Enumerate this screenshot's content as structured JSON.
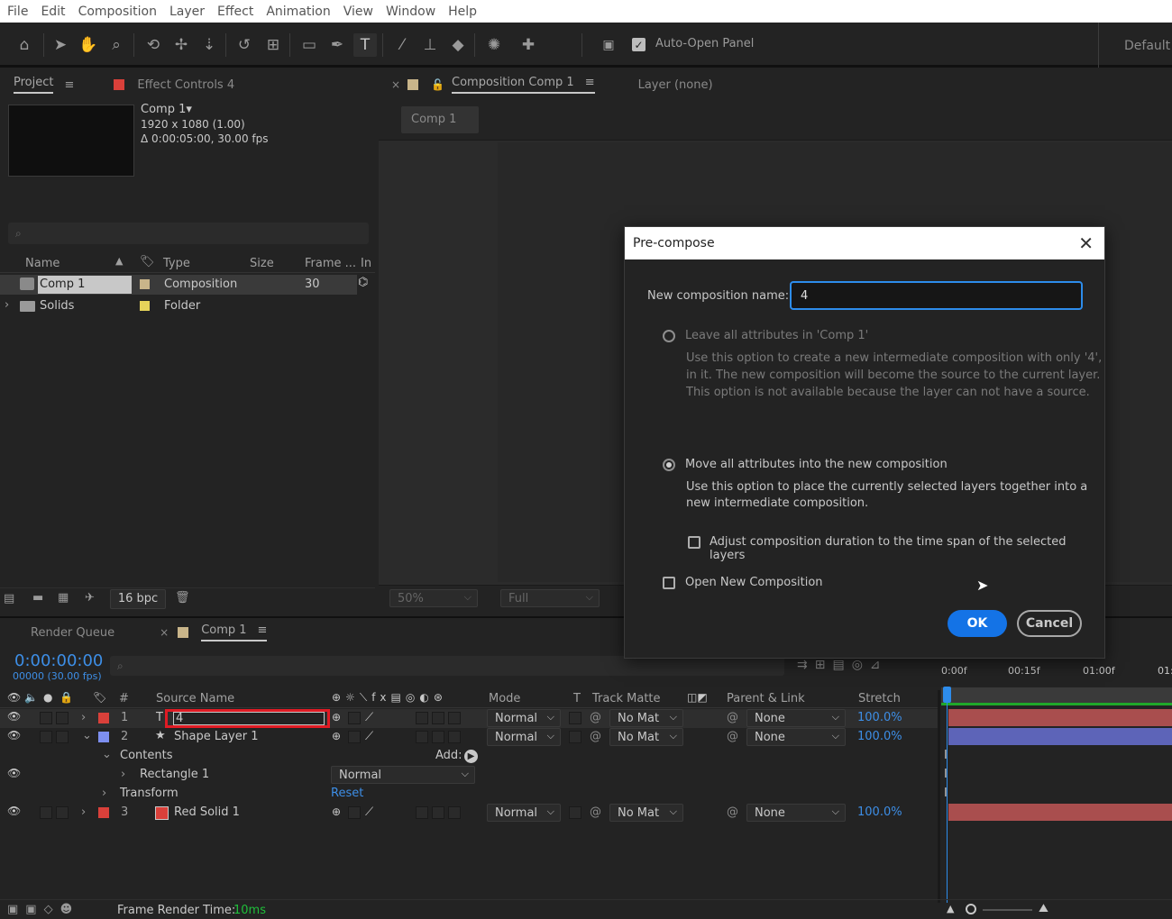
{
  "menu": [
    "File",
    "Edit",
    "Composition",
    "Layer",
    "Effect",
    "Animation",
    "View",
    "Window",
    "Help"
  ],
  "toolbar": {
    "auto_open_label": "Auto-Open Panel",
    "workspace": "Default"
  },
  "project_panel": {
    "tab_project": "Project",
    "tab_effects": "Effect Controls 4",
    "comp_name": "Comp 1▾",
    "comp_res": "1920 x 1080 (1.00)",
    "comp_dur": "Δ 0:00:05:00, 30.00 fps",
    "columns": {
      "name": "Name",
      "type": "Type",
      "size": "Size",
      "frame": "Frame ...",
      "in": "In"
    },
    "items": [
      {
        "name": "Comp 1",
        "type": "Composition",
        "frame": "30"
      },
      {
        "name": "Solids",
        "type": "Folder",
        "frame": ""
      }
    ],
    "bpc": "16 bpc"
  },
  "comp_panel": {
    "tab_comp": "Composition Comp 1",
    "tab_layer": "Layer (none)",
    "breadcrumb": "Comp 1",
    "zoom": "50%",
    "resolution": "Full"
  },
  "timeline": {
    "tab_render": "Render Queue",
    "tab_comp": "Comp 1",
    "timecode": "0:00:00:00",
    "frames": "00000 (30.00 fps)",
    "columns": {
      "num": "#",
      "source": "Source Name",
      "mode": "Mode",
      "t": "T",
      "track": "Track Matte",
      "parent": "Parent & Link",
      "stretch": "Stretch"
    },
    "ruler": [
      "0:00f",
      "00:15f",
      "01:00f",
      "01:"
    ],
    "layers": [
      {
        "num": "1",
        "name": "4",
        "mode": "Normal",
        "matte": "No Mat",
        "parent": "None",
        "stretch": "100.0%"
      },
      {
        "num": "2",
        "name": "Shape Layer 1",
        "mode": "Normal",
        "matte": "No Mat",
        "parent": "None",
        "stretch": "100.0%"
      },
      {
        "num": "3",
        "name": "Red Solid 1",
        "mode": "Normal",
        "matte": "No Mat",
        "parent": "None",
        "stretch": "100.0%"
      }
    ],
    "contents_label": "Contents",
    "add_label": "Add:",
    "rect_label": "Rectangle 1",
    "rect_mode": "Normal",
    "transform_label": "Transform",
    "reset_label": "Reset",
    "footer_label": "Frame Render Time:",
    "footer_value": "10ms"
  },
  "dialog": {
    "title": "Pre-compose",
    "name_label": "New composition name:",
    "name_value": "4",
    "opt1_label": "Leave all attributes in 'Comp 1'",
    "opt1_desc1": "Use this option to create a new intermediate composition with only '4',",
    "opt1_desc2": "in it. The new composition will become the source to the current layer.",
    "opt1_desc3": "This option is not available because the layer can not have a source.",
    "opt2_label": "Move all attributes into the new composition",
    "opt2_desc1": "Use this option to place the currently selected layers together into a",
    "opt2_desc2": "new intermediate composition.",
    "adjust_label": "Adjust composition duration to the time span of the selected layers",
    "open_label": "Open New Composition",
    "ok": "OK",
    "cancel": "Cancel"
  },
  "colors": {
    "accent": "#2d8ceb",
    "red_label": "#d9403a",
    "blue_label": "#7d8ff0",
    "bar_red": "#a94e4e",
    "bar_blue": "#5d64b8"
  }
}
